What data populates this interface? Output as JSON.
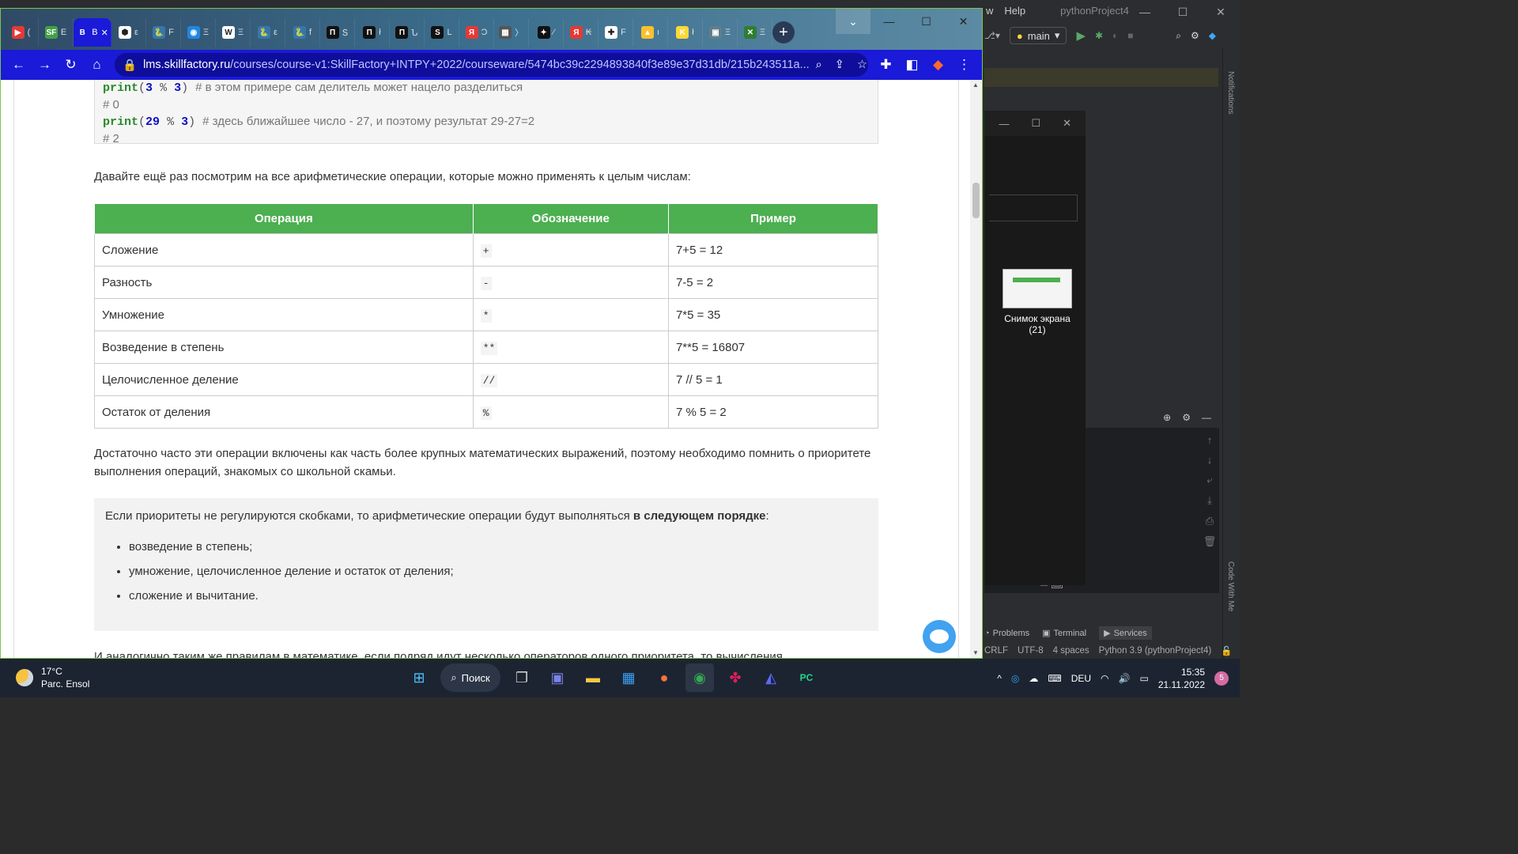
{
  "ide": {
    "menu_partial": "w",
    "menu_help": "Help",
    "project_title": "pythonProject4",
    "branch": "main",
    "tool_tabs": [
      "Problems",
      "Terminal",
      "Services"
    ],
    "status": [
      "CRLF",
      "UTF-8",
      "4 spaces",
      "Python 3.9 (pythonProject4)"
    ],
    "right_strip": [
      "Notifications",
      "Code With Me"
    ]
  },
  "desktop_icon": {
    "label": "Снимок экрана (21)"
  },
  "chrome": {
    "tabs": [
      {
        "label": "(",
        "color": "#e53935",
        "glyph": "▶"
      },
      {
        "label": "E",
        "color": "#43a047",
        "glyph": "SF"
      },
      {
        "label": "B",
        "color": "#1a1ad8",
        "glyph": "B",
        "active": true
      },
      {
        "label": "ε",
        "color": "#ffffff",
        "glyph": "⬢"
      },
      {
        "label": "F",
        "color": "#3776ab",
        "glyph": "🐍"
      },
      {
        "label": "Ξ",
        "color": "#1e88e5",
        "glyph": "◉"
      },
      {
        "label": "Ξ",
        "color": "#ffffff",
        "glyph": "W"
      },
      {
        "label": "ε",
        "color": "#3776ab",
        "glyph": "🐍"
      },
      {
        "label": "f",
        "color": "#3776ab",
        "glyph": "🐍"
      },
      {
        "label": "Տ",
        "color": "#111111",
        "glyph": "П"
      },
      {
        "label": "ł",
        "color": "#111111",
        "glyph": "П"
      },
      {
        "label": "Ն",
        "color": "#111111",
        "glyph": "П"
      },
      {
        "label": "L",
        "color": "#111111",
        "glyph": "S"
      },
      {
        "label": "Ͻ",
        "color": "#e53935",
        "glyph": "Я"
      },
      {
        "label": "〉",
        "color": "#555555",
        "glyph": "▦"
      },
      {
        "label": "⁄",
        "color": "#111111",
        "glyph": "✦"
      },
      {
        "label": "₭",
        "color": "#e53935",
        "glyph": "Я"
      },
      {
        "label": "F",
        "color": "#ffffff",
        "glyph": "✚"
      },
      {
        "label": "ı",
        "color": "#fbc02d",
        "glyph": "▲"
      },
      {
        "label": "ł",
        "color": "#fdd835",
        "glyph": "K"
      },
      {
        "label": "Ξ",
        "color": "#607d8b",
        "glyph": "▣"
      },
      {
        "label": "Ξ",
        "color": "#2e7d32",
        "glyph": "✕"
      }
    ],
    "url_host": "lms.skillfactory.ru",
    "url_path": "/courses/course-v1:SkillFactory+INTPY+2022/courseware/5474bc39c2294893840f3e89e37d31db/215b243511a..."
  },
  "page": {
    "code_lines": [
      {
        "kind": "code",
        "fn": "print",
        "a": "3",
        "op": "%",
        "b": "3",
        "comment": "# в этом примере сам делитель может нацело разделиться"
      },
      {
        "kind": "out",
        "text": "# 0"
      },
      {
        "kind": "code",
        "fn": "print",
        "a": "29",
        "op": "%",
        "b": "3",
        "comment": "# здесь ближайшее число - 27, и поэтому результат 29-27=2"
      },
      {
        "kind": "out",
        "text": "# 2"
      }
    ],
    "intro": "Давайте ещё раз посмотрим на все арифметические операции, которые можно применять к целым числам:",
    "table": {
      "headers": [
        "Операция",
        "Обозначение",
        "Пример"
      ],
      "rows": [
        [
          "Сложение",
          "+",
          "7+5 = 12"
        ],
        [
          "Разность",
          "-",
          "7-5 = 2"
        ],
        [
          "Умножение",
          "*",
          "7*5 = 35"
        ],
        [
          "Возведение в степень",
          "**",
          "7**5 = 16807"
        ],
        [
          "Целочисленное деление",
          "//",
          "7 // 5 = 1"
        ],
        [
          "Остаток от деления",
          "%",
          "7 % 5 = 2"
        ]
      ]
    },
    "para2": "Достаточно часто эти операции включены как часть более крупных математических выражений, поэтому необходимо помнить о приоритете выполнения операций, знакомых со школьной скамьи.",
    "note_lead": "Если приоритеты не регулируются скобками, то арифметические операции будут выполняться ",
    "note_bold": "в следующем порядке",
    "note_tail": ":",
    "note_items": [
      "возведение в степень;",
      "умножение, целочисленное деление и остаток от деления;",
      "сложение и вычитание."
    ],
    "para3": "И аналогично таким же правилам в математике, если подряд идут несколько операторов одного приоритета, то вычисления"
  },
  "taskbar": {
    "temp": "17°C",
    "weather": "Parc. Ensol",
    "search": "Поиск",
    "lang": "DEU",
    "time": "15:35",
    "date": "21.11.2022",
    "badge": "5"
  }
}
